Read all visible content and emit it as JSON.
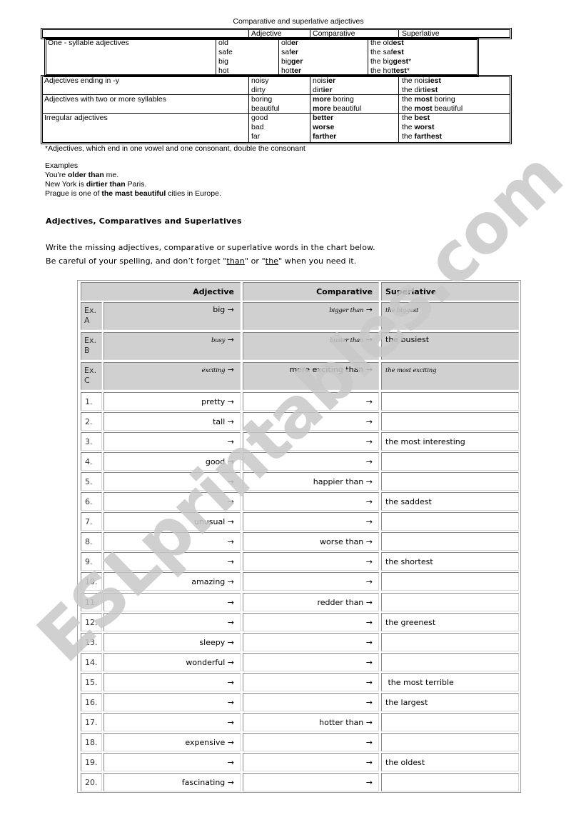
{
  "document": {
    "title": "Comparative and superlative adjectives"
  },
  "reference_table": {
    "headers": {
      "category": "",
      "adjective": "Adjective",
      "comparative": "Comparative",
      "superlative": "Superlative"
    },
    "groups": [
      {
        "category": "One - syllable adjectives",
        "rows": [
          {
            "adjective": "old",
            "comp_base": "old",
            "comp_suffix": "er",
            "sup_base": "the old",
            "sup_suffix": "est",
            "sup_mark": ""
          },
          {
            "adjective": "safe",
            "comp_base": "saf",
            "comp_suffix": "er",
            "sup_base": "the saf",
            "sup_suffix": "est",
            "sup_mark": ""
          },
          {
            "adjective": "big",
            "comp_base": "big",
            "comp_suffix": "ger",
            "sup_base": "the big",
            "sup_suffix": "gest",
            "sup_mark": "*"
          },
          {
            "adjective": "hot",
            "comp_base": "hot",
            "comp_suffix": "ter",
            "sup_base": "the hot",
            "sup_suffix": "test",
            "sup_mark": "*"
          }
        ]
      },
      {
        "category": "Adjectives ending in -y",
        "rows": [
          {
            "adjective": "noisy",
            "comp_base": "nois",
            "comp_suffix": "ier",
            "sup_base": "the nois",
            "sup_suffix": "iest"
          },
          {
            "adjective": "dirty",
            "comp_base": "dirt",
            "comp_suffix": "ier",
            "sup_base": "the dirt",
            "sup_suffix": "iest"
          }
        ]
      },
      {
        "category": "Adjectives with two or more syllables",
        "rows": [
          {
            "adjective": "boring",
            "comp_bold": "more",
            "comp_rest": " boring",
            "sup_pre": "the ",
            "sup_bold": "most",
            "sup_rest": " boring"
          },
          {
            "adjective": "beautiful",
            "comp_bold": "more",
            "comp_rest": " beautiful",
            "sup_pre": "the ",
            "sup_bold": "most",
            "sup_rest": " beautiful"
          }
        ]
      },
      {
        "category": "Irregular adjectives",
        "rows": [
          {
            "adjective": "good",
            "comparative": "better",
            "sup_pre": "the ",
            "sup_bold": "best"
          },
          {
            "adjective": "bad",
            "comparative": "worse",
            "sup_pre": "the ",
            "sup_bold": "worst"
          },
          {
            "adjective": "far",
            "comparative": "farther",
            "sup_pre": "the ",
            "sup_bold": "farthest"
          }
        ]
      }
    ],
    "footnote": "*Adjectives, which end in one vowel and one consonant, double the consonant"
  },
  "examples": {
    "label": "Examples",
    "sentences": [
      {
        "pre": "You're ",
        "bold": "older than",
        "post": " me."
      },
      {
        "pre": "New York is ",
        "bold": "dirtier than",
        "post": " Paris."
      },
      {
        "pre": "Prague is one of ",
        "bold": "the mast beautiful",
        "post": " cities in Europe."
      }
    ]
  },
  "exercise": {
    "title": "Adjectives, Comparatives and Superlatives",
    "instruction_1": "Write the missing adjectives, comparative or superlative words in the chart below.",
    "instruction_2_pre": "Be careful of your spelling, and don’t forget \"",
    "instruction_2_than": "than",
    "instruction_2_mid": "\" or \"",
    "instruction_2_the": "the",
    "instruction_2_post": "\" when you need it.",
    "headers": {
      "adjective": "Adjective",
      "comparative": "Comparative",
      "superlative": "Superlative"
    },
    "arrow": "→",
    "examples": [
      {
        "label": "Ex. A",
        "adjective": "big",
        "comparative": "bigger than",
        "superlative": "the biggest",
        "adj_handwritten": false,
        "comp_handwritten": true,
        "sup_handwritten": true
      },
      {
        "label": "Ex. B",
        "adjective": "busy",
        "comparative": "busier than",
        "superlative": "the busiest",
        "adj_handwritten": true,
        "comp_handwritten": true,
        "sup_handwritten": false
      },
      {
        "label": "Ex. C",
        "adjective": "exciting",
        "comparative": "more exciting than",
        "superlative": "the most exciting",
        "adj_handwritten": true,
        "comp_handwritten": false,
        "sup_handwritten": true
      }
    ],
    "rows": [
      {
        "num": "1.",
        "adjective": "pretty",
        "comparative": "",
        "superlative": ""
      },
      {
        "num": "2.",
        "adjective": "tall",
        "comparative": "",
        "superlative": ""
      },
      {
        "num": "3.",
        "adjective": "",
        "comparative": "",
        "superlative": "the most interesting"
      },
      {
        "num": "4.",
        "adjective": "good",
        "comparative": "",
        "superlative": ""
      },
      {
        "num": "5.",
        "adjective": "",
        "comparative": "happier than",
        "superlative": ""
      },
      {
        "num": "6.",
        "adjective": "",
        "comparative": "",
        "superlative": "the saddest"
      },
      {
        "num": "7.",
        "adjective": "unusual",
        "comparative": "",
        "superlative": ""
      },
      {
        "num": "8.",
        "adjective": "",
        "comparative": "worse than",
        "superlative": ""
      },
      {
        "num": "9.",
        "adjective": "",
        "comparative": "",
        "superlative": "the shortest"
      },
      {
        "num": "10.",
        "adjective": "amazing",
        "comparative": "",
        "superlative": ""
      },
      {
        "num": "11.",
        "adjective": "",
        "comparative": "redder than",
        "superlative": ""
      },
      {
        "num": "12.",
        "adjective": "",
        "comparative": "",
        "superlative": "the greenest"
      },
      {
        "num": "13.",
        "adjective": "sleepy",
        "comparative": "",
        "superlative": ""
      },
      {
        "num": "14.",
        "adjective": "wonderful",
        "comparative": "",
        "superlative": ""
      },
      {
        "num": "15.",
        "adjective": "",
        "comparative": "",
        "superlative": " the most terrible"
      },
      {
        "num": "16.",
        "adjective": "",
        "comparative": "",
        "superlative": "the largest"
      },
      {
        "num": "17.",
        "adjective": "",
        "comparative": "hotter than",
        "superlative": ""
      },
      {
        "num": "18.",
        "adjective": "expensive",
        "comparative": "",
        "superlative": ""
      },
      {
        "num": "19.",
        "adjective": "",
        "comparative": "",
        "superlative": "the oldest"
      },
      {
        "num": "20.",
        "adjective": "fascinating",
        "comparative": "",
        "superlative": ""
      }
    ]
  },
  "watermark": {
    "text": "ESLprintables.com",
    "color": "#c8c8c8"
  }
}
